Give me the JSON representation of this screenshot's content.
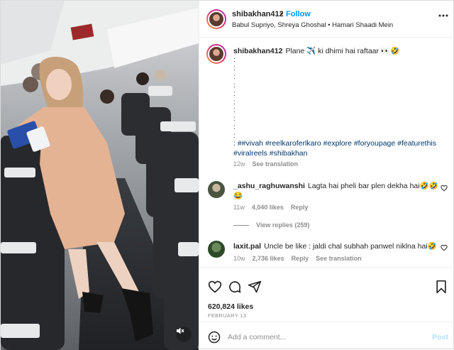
{
  "post": {
    "username": "shibakhan412",
    "separator": "•",
    "follow_label": "Follow",
    "audio": "Babul Supriyo, Shreya Ghoshal • Hamari Shaadi Mein",
    "more_icon": "more-horizontal-icon"
  },
  "caption": {
    "username": "shibakhan412",
    "text": "Plane ✈️ ki dhimi hai raftaar 👀🤣",
    "filler_lines": ":\n:\n:\n:\n:\n:\n:\n:\n:\n:",
    "hashtags": ": ##vivah #reelkaroferlkaro #explore #foryoupage #featurethis #viralreels #shibakhan",
    "age": "12w",
    "see_translation": "See translation"
  },
  "comments": [
    {
      "username": "_ashu_raghuwanshi",
      "text": "Lagta hai pheli bar plen dekha hai🤣🤣😂",
      "age": "11w",
      "likes": "4,040 likes",
      "reply": "Reply",
      "view_replies": "View replies (259)"
    },
    {
      "username": "laxit.pal",
      "text": "Uncle be like : jaldi chal subhah panwel niklna hai🤣",
      "age": "10w",
      "likes": "2,736 likes",
      "reply": "Reply",
      "see_translation": "See translation"
    }
  ],
  "actions": {
    "like_icon": "heart-icon",
    "comment_icon": "comment-icon",
    "share_icon": "send-icon",
    "save_icon": "bookmark-icon",
    "likes": "620,824 likes",
    "date": "FEBRUARY 13"
  },
  "add_comment": {
    "placeholder": "Add a comment...",
    "post_label": "Post"
  },
  "media": {
    "mute_icon": "speaker-muted-icon"
  },
  "colors": {
    "accent": "#0095f6",
    "link": "#00376b",
    "muted": "#8e8e8e",
    "post_disabled": "#b2dffc"
  }
}
